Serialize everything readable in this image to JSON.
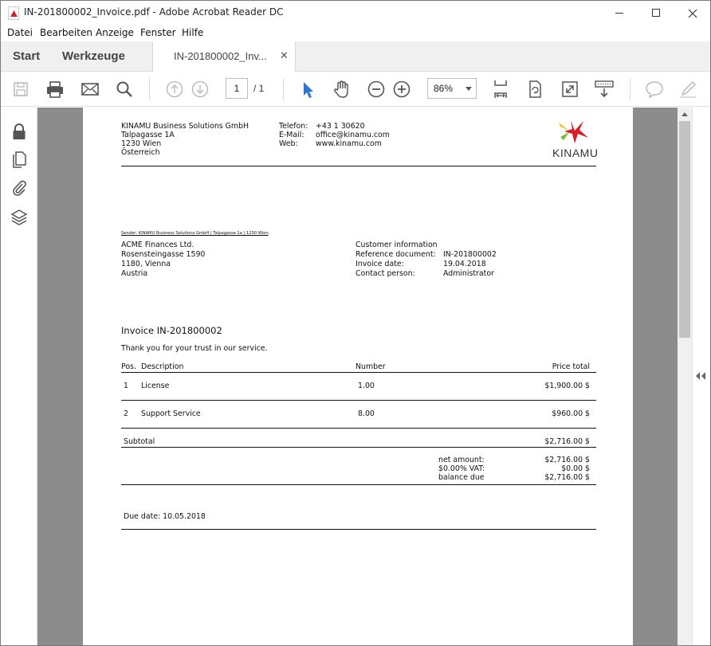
{
  "window": {
    "title": "IN-201800002_Invoice.pdf - Adobe Acrobat Reader DC"
  },
  "menu": [
    "Datei",
    "Bearbeiten",
    "Anzeige",
    "Fenster",
    "Hilfe"
  ],
  "tabs": {
    "home": "Start",
    "tools": "Werkzeuge",
    "document": "IN-201800002_Inv...",
    "close_glyph": "✕"
  },
  "toolbar": {
    "page_current": "1",
    "page_total": "/ 1",
    "zoom": "86%"
  },
  "colors": {
    "accent_blue": "#2b78d4",
    "logo_red": "#d61f26",
    "logo_yellow": "#f2c01e",
    "logo_green": "#7db928"
  },
  "document": {
    "company": {
      "name": "KINAMU Business Solutions GmbH",
      "street": "Talpagasse 1A",
      "city": "1230 Wien",
      "country": "Österreich"
    },
    "contact": {
      "phone_label": "Telefon:",
      "phone": "+43 1 30620",
      "email_label": "E-Mail:",
      "email": "office@kinamu.com",
      "web_label": "Web:",
      "web": "www.kinamu.com"
    },
    "logo_text": "KINAMU",
    "sender_line": "Sender: KINAMU Business Solutions GmbH | Talpagasse 1a | 1230 Wien",
    "recipient": {
      "name": "ACME Finances Ltd.",
      "street": "Rosensteingasse 1590",
      "city": "1180, Vienna",
      "country": "Austria"
    },
    "customer_info": {
      "heading": "Customer information",
      "ref_label": "Reference document:",
      "ref": "IN-201800002",
      "date_label": "Invoice date:",
      "date": "19.04.2018",
      "person_label": "Contact person:",
      "person": "Administrator"
    },
    "invoice_title": "Invoice IN-201800002",
    "thanks": "Thank you for your trust in our service.",
    "table_headers": {
      "pos": "Pos.",
      "description": "Description",
      "number": "Number",
      "price": "Price total"
    },
    "rows": [
      {
        "pos": "1",
        "description": "License",
        "number": "1.00",
        "price": "$1,900.00 $"
      },
      {
        "pos": "2",
        "description": "Support Service",
        "number": "8.00",
        "price": "$960.00 $"
      }
    ],
    "subtotal_label": "Subtotal",
    "subtotal": "$2,716.00 $",
    "totals": [
      {
        "label": "net amount:",
        "value": "$2,716.00 $"
      },
      {
        "label": "$0.00% VAT:",
        "value": "$0.00 $"
      },
      {
        "label": "balance due",
        "value": "$2,716.00 $"
      }
    ],
    "due_date": "Due date: 10.05.2018"
  }
}
